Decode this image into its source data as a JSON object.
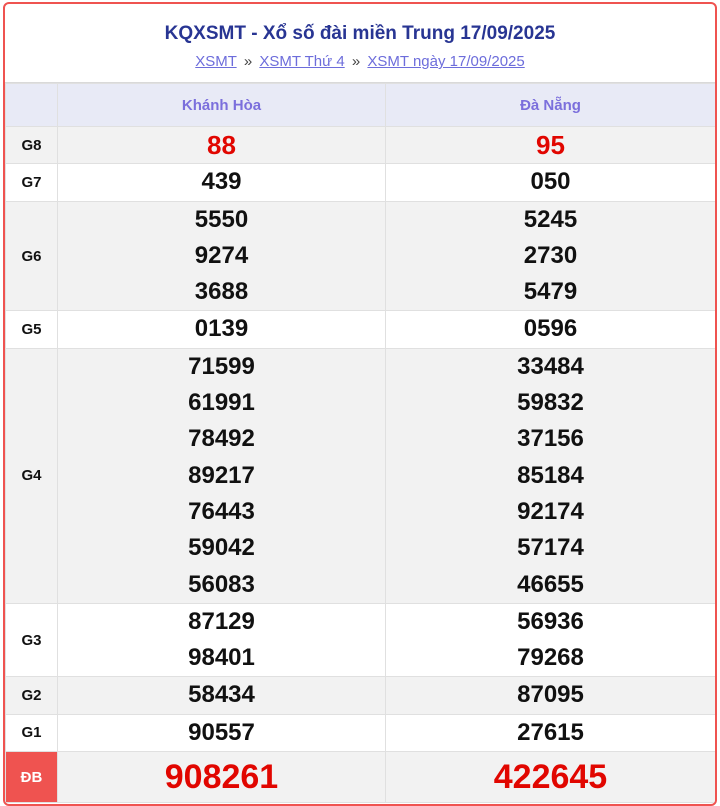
{
  "header": {
    "title": "KQXSMT - Xổ số đài miền Trung 17/09/2025",
    "breadcrumbs": [
      "XSMT",
      "XSMT Thứ 4",
      "XSMT ngày 17/09/2025"
    ],
    "separator": "»"
  },
  "table": {
    "columns": [
      "Khánh Hòa",
      "Đà Nẵng"
    ],
    "rows": [
      {
        "label": "G8",
        "c1": [
          "88"
        ],
        "c2": [
          "95"
        ]
      },
      {
        "label": "G7",
        "c1": [
          "439"
        ],
        "c2": [
          "050"
        ]
      },
      {
        "label": "G6",
        "c1": [
          "5550",
          "9274",
          "3688"
        ],
        "c2": [
          "5245",
          "2730",
          "5479"
        ]
      },
      {
        "label": "G5",
        "c1": [
          "0139"
        ],
        "c2": [
          "0596"
        ]
      },
      {
        "label": "G4",
        "c1": [
          "71599",
          "61991",
          "78492",
          "89217",
          "76443",
          "59042",
          "56083"
        ],
        "c2": [
          "33484",
          "59832",
          "37156",
          "85184",
          "92174",
          "57174",
          "46655"
        ]
      },
      {
        "label": "G3",
        "c1": [
          "87129",
          "98401"
        ],
        "c2": [
          "56936",
          "79268"
        ]
      },
      {
        "label": "G2",
        "c1": [
          "58434"
        ],
        "c2": [
          "87095"
        ]
      },
      {
        "label": "G1",
        "c1": [
          "90557"
        ],
        "c2": [
          "27615"
        ]
      },
      {
        "label": "ĐB",
        "c1": [
          "908261"
        ],
        "c2": [
          "422645"
        ]
      }
    ]
  },
  "colors": {
    "border": "#ef5350",
    "title": "#283593",
    "header_text": "#7b6fdc",
    "special_numbers": "#e10600"
  }
}
